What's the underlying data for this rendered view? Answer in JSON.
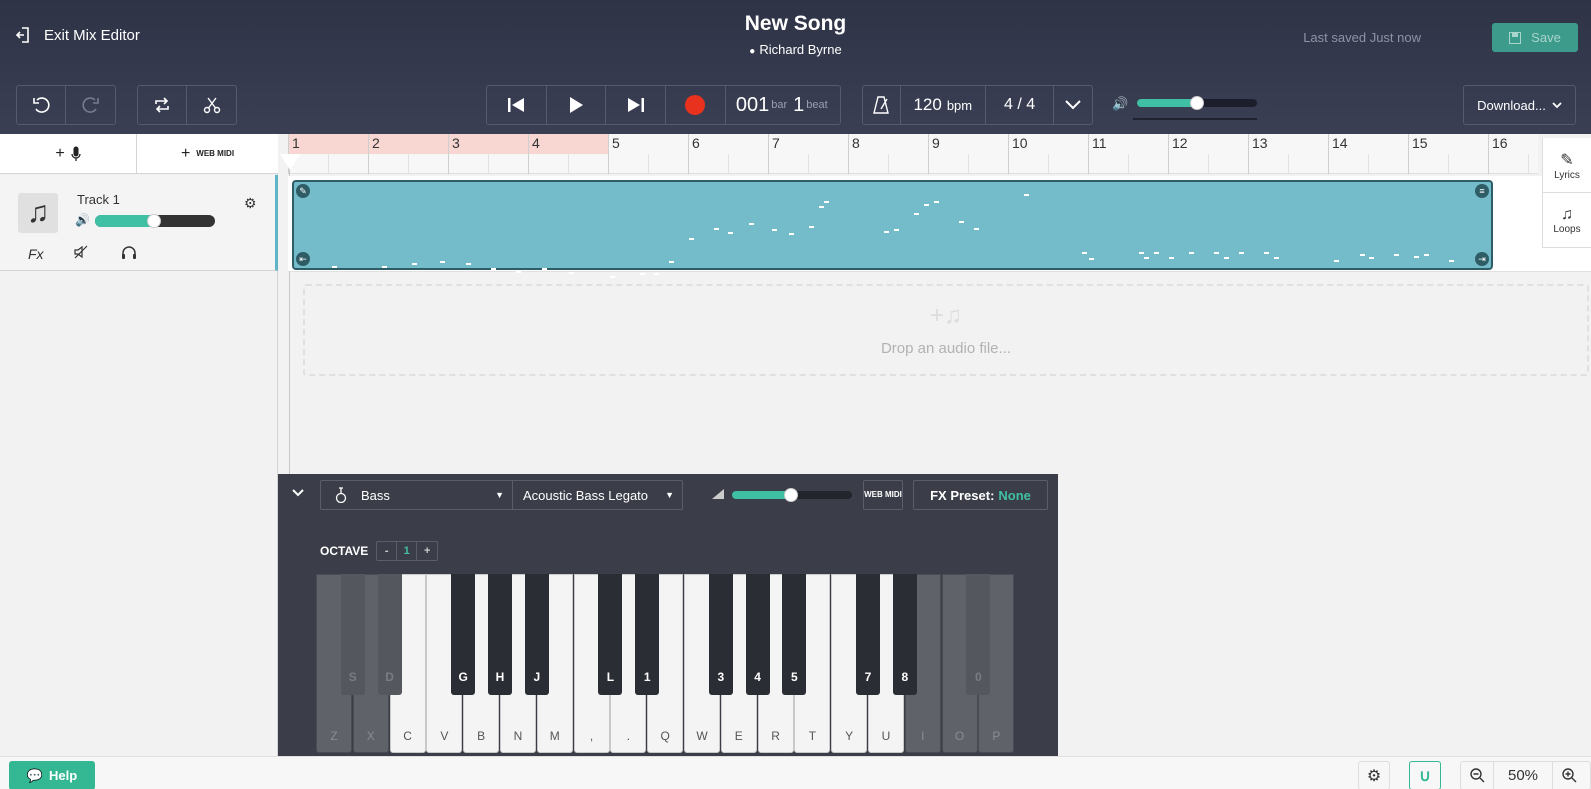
{
  "header": {
    "exit_label": "Exit Mix Editor",
    "song_title": "New Song",
    "author": "Richard Byrne",
    "last_saved": "Last saved Just now",
    "save_label": "Save"
  },
  "transport": {
    "bar": "001",
    "bar_unit": "bar",
    "beat": "1",
    "beat_unit": "beat",
    "tempo": "120",
    "tempo_unit": "bpm",
    "time_sig_num": "4",
    "time_sig_sep": "/",
    "time_sig_den": "4",
    "master_volume": 0.5
  },
  "download_label": "Download...",
  "track_list": {
    "add_midi_label": "WEB MIDI",
    "tracks": [
      {
        "name": "Track 1",
        "volume": 0.5,
        "fx_label": "Fx"
      }
    ]
  },
  "timeline": {
    "bars": [
      "1",
      "2",
      "3",
      "4",
      "5",
      "6",
      "7",
      "8",
      "9",
      "10",
      "11",
      "12",
      "13",
      "14",
      "15",
      "16"
    ],
    "loop_bars": [
      1,
      4
    ]
  },
  "dropzone_text": "Drop an audio file...",
  "right_tabs": [
    "Lyrics",
    "Loops"
  ],
  "keyboard_panel": {
    "instrument": "Bass",
    "preset": "Acoustic Bass Legato",
    "volume": 0.5,
    "webmidi_label": "WEB MIDI",
    "fx_preset_label": "FX Preset:",
    "fx_preset_value": "None",
    "octave_label": "OCTAVE",
    "octave_minus": "-",
    "octave_value": "1",
    "octave_plus": "+",
    "white_keys": [
      "Z",
      "X",
      "C",
      "V",
      "B",
      "N",
      "M",
      ",",
      ".",
      "Q",
      "W",
      "E",
      "R",
      "T",
      "Y",
      "U",
      "I",
      "O",
      "P"
    ],
    "black_keys": [
      {
        "label": "S",
        "disabled": true
      },
      {
        "label": "D",
        "disabled": true
      },
      {
        "label": "G",
        "disabled": false
      },
      {
        "label": "H",
        "disabled": false
      },
      {
        "label": "J",
        "disabled": false
      },
      {
        "label": "L",
        "disabled": false
      },
      {
        "label": "1",
        "disabled": false
      },
      {
        "label": "3",
        "disabled": false
      },
      {
        "label": "4",
        "disabled": false
      },
      {
        "label": "5",
        "disabled": false
      },
      {
        "label": "7",
        "disabled": false
      },
      {
        "label": "8",
        "disabled": false
      },
      {
        "label": "0",
        "disabled": true
      }
    ]
  },
  "footer": {
    "help_label": "Help",
    "zoom_value": "50%"
  },
  "colors": {
    "accent": "#3fbfa4",
    "clip": "#74bcca",
    "record": "#e8321e",
    "loop_region": "#f8d7d3"
  }
}
